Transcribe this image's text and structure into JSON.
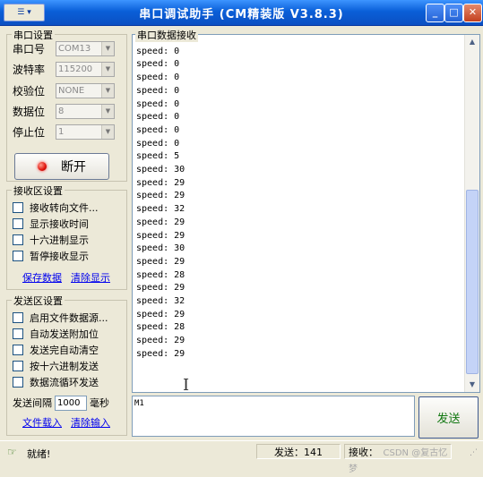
{
  "window": {
    "title": "串口调试助手 (CM精装版 V3.8.3)",
    "sysmenu": "☰ ▾",
    "min": "_",
    "max": "□",
    "close": "✕"
  },
  "port": {
    "group_title": "串口设置",
    "fields": [
      {
        "label": "串口号",
        "value": "COM13"
      },
      {
        "label": "波特率",
        "value": "115200"
      },
      {
        "label": "校验位",
        "value": "NONE"
      },
      {
        "label": "数据位",
        "value": "8"
      },
      {
        "label": "停止位",
        "value": "1"
      }
    ],
    "toggle_label": "断开",
    "connected": true
  },
  "recv_settings": {
    "group_title": "接收区设置",
    "options": [
      {
        "label": "接收转向文件...",
        "checked": false
      },
      {
        "label": "显示接收时间",
        "checked": false
      },
      {
        "label": "十六进制显示",
        "checked": false
      },
      {
        "label": "暂停接收显示",
        "checked": false
      }
    ],
    "save_link": "保存数据",
    "clear_link": "清除显示"
  },
  "send_settings": {
    "group_title": "发送区设置",
    "options": [
      {
        "label": "启用文件数据源...",
        "checked": false
      },
      {
        "label": "自动发送附加位",
        "checked": false
      },
      {
        "label": "发送完自动清空",
        "checked": false
      },
      {
        "label": "按十六进制发送",
        "checked": false
      },
      {
        "label": "数据流循环发送",
        "checked": false
      }
    ],
    "interval_label": "发送间隔",
    "interval_value": "1000",
    "interval_unit": "毫秒",
    "load_link": "文件载入",
    "clear_input_link": "清除输入"
  },
  "receive": {
    "title": "串口数据接收",
    "lines": [
      "speed: 0",
      "speed: 0",
      "speed: 0",
      "speed: 0",
      "speed: 0",
      "speed: 0",
      "speed: 0",
      "speed: 0",
      "speed: 0",
      "speed: 5",
      "speed: 30",
      "speed: 29",
      "speed: 29",
      "speed: 32",
      "speed: 29",
      "speed: 29",
      "speed: 30",
      "speed: 29",
      "speed: 28",
      "speed: 29",
      "speed: 32",
      "speed: 29",
      "speed: 28",
      "speed: 29",
      "speed: 29"
    ]
  },
  "send": {
    "input_value": "M1",
    "button_label": "发送"
  },
  "status": {
    "ready": "就绪!",
    "sent": "发送：141",
    "recv": "接收：",
    "watermark": "CSDN @复古忆梦"
  }
}
